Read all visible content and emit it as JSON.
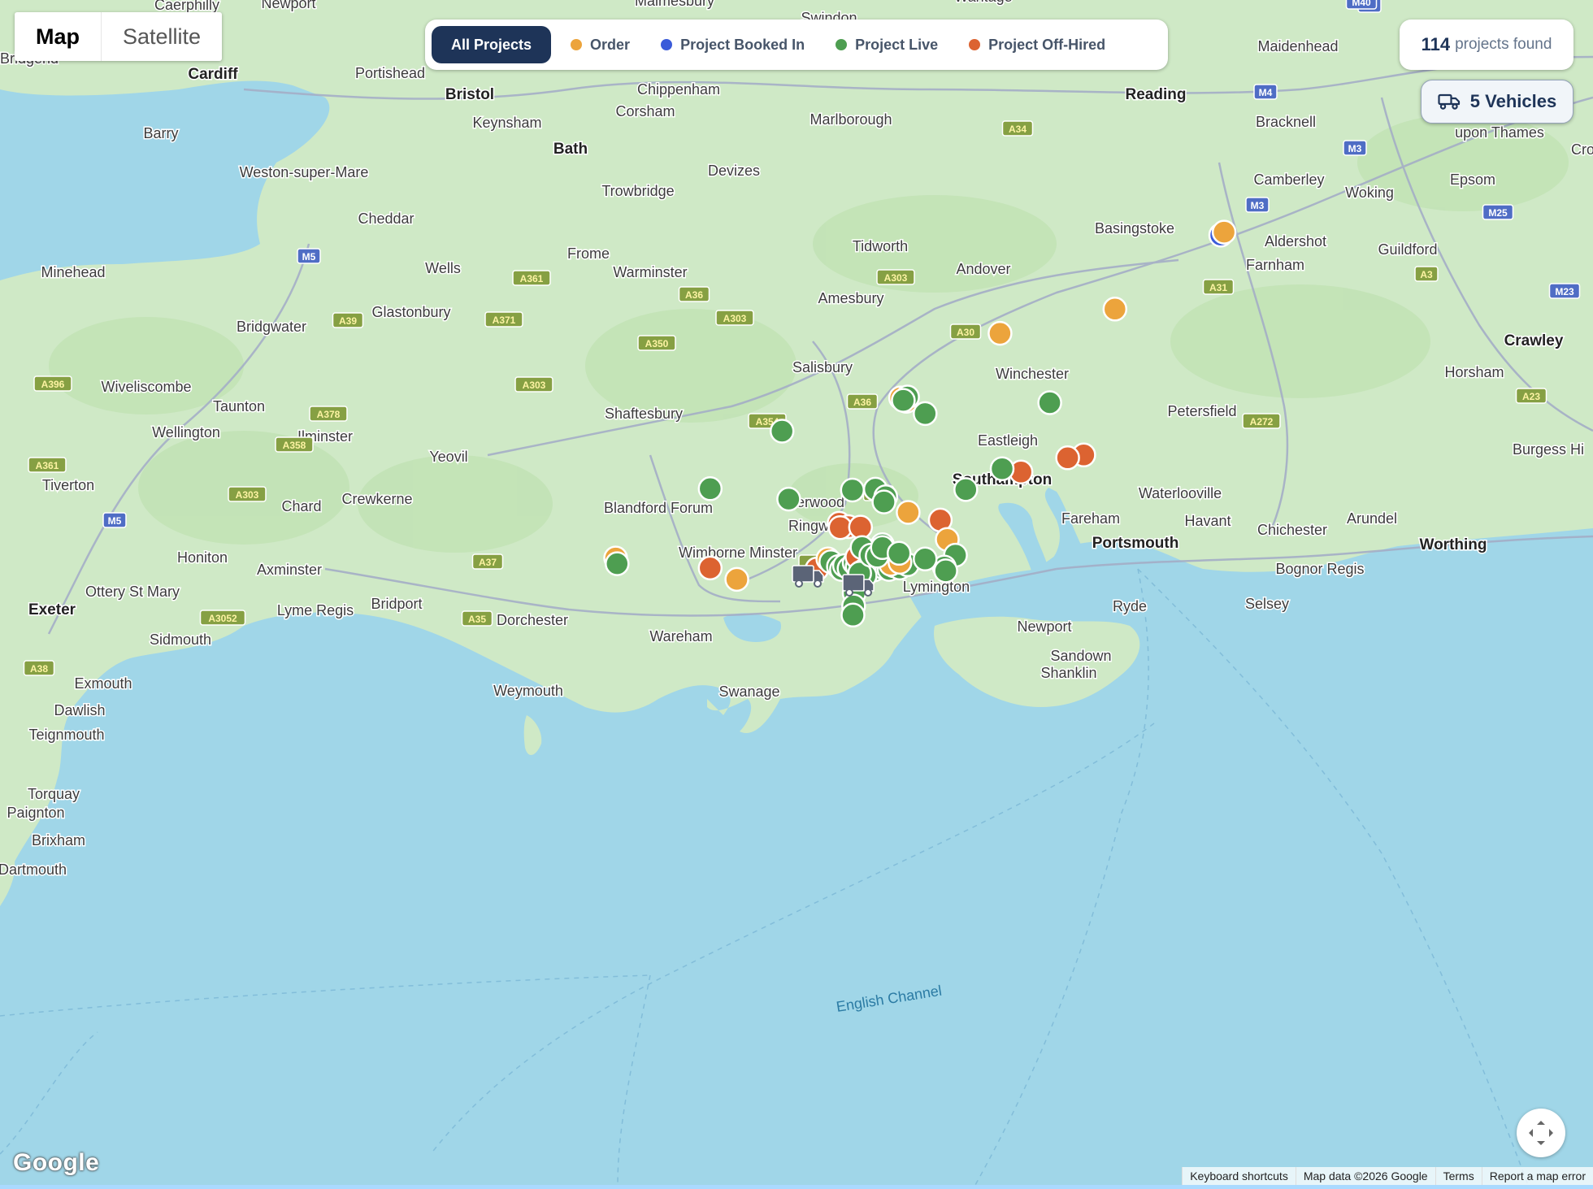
{
  "map_type": {
    "options": [
      "Map",
      "Satellite"
    ],
    "selected": "Map"
  },
  "filters": [
    {
      "label": "All Projects",
      "active": true
    },
    {
      "label": "Order",
      "color": "#eca43c"
    },
    {
      "label": "Project Booked In",
      "color": "#3b5bd9"
    },
    {
      "label": "Project Live",
      "color": "#4e9e51"
    },
    {
      "label": "Project Off-Hired",
      "color": "#dc6331"
    }
  ],
  "summary": {
    "count": "114",
    "count_label": "projects found",
    "vehicles_label": "5 Vehicles"
  },
  "attribution": {
    "logo": "Google",
    "links": [
      "Keyboard shortcuts",
      "Map data ©2026 Google",
      "Terms",
      "Report a map error"
    ]
  },
  "sea_labels": [
    "English Channel"
  ],
  "places": [
    "Caerphilly",
    "Newport",
    "Malmesbury",
    "Swindon",
    "Wantage",
    "Maidenhead",
    "Cardiff",
    "Portishead",
    "Bristol",
    "Chippenham",
    "Reading",
    "Barry",
    "Keynsham",
    "Corsham",
    "Marlborough",
    "upon Thames",
    "Croydo",
    "Bath",
    "Weston-super-Mare",
    "Devizes",
    "Camberley",
    "Woking",
    "Epsom",
    "Trowbridge",
    "Cheddar",
    "Basingstoke",
    "Aldershot",
    "Guildford",
    "Frome",
    "Tidworth",
    "Farnham",
    "Minehead",
    "Wells",
    "Warminster",
    "Andover",
    "Amesbury",
    "Glastonbury",
    "Bridgwater",
    "Crawley",
    "Wiveliscombe",
    "Horsham",
    "Taunton",
    "Shaftesbury",
    "Wellington",
    "Petersfield",
    "Eastleigh",
    "Burgess Hi",
    "Ilminster",
    "Yeovil",
    "Southampton",
    "Tiverton",
    "Crewkerne",
    "Chard",
    "Waterlooville",
    "Fareham",
    "Havant",
    "Arundel",
    "Portsmouth",
    "Chichester",
    "Worthing",
    "Honiton",
    "Axminster",
    "Blandford Forum",
    "Verwood",
    "Ringwood",
    "Wimborne Minster",
    "Lymington",
    "Ottery St Mary",
    "Lyme Regis",
    "Bridport",
    "Dorchester",
    "Ryde",
    "Newport",
    "Bognor Regis",
    "Selsey",
    "Exeter",
    "Sidmouth",
    "Wareham",
    "Sandown",
    "Shanklin",
    "Exmouth",
    "Dawlish",
    "Weymouth",
    "Swanage",
    "Teignmouth",
    "Torquay",
    "Paignton",
    "Brixham",
    "Dartmouth",
    "Bracknell",
    "Winchester",
    "Salisbury",
    "Bridgend"
  ],
  "roads": [
    "M4",
    "M40",
    "A34",
    "M3",
    "M25",
    "A3",
    "M23",
    "A31",
    "A303",
    "A30",
    "A361",
    "A36",
    "A371",
    "A303",
    "A350",
    "M5",
    "A39",
    "A396",
    "A303",
    "A378",
    "A358",
    "A354",
    "A36",
    "A31",
    "A338",
    "A35",
    "A37",
    "A361",
    "A303",
    "A3052",
    "A38",
    "M5",
    "A23",
    "A272",
    "M4",
    "M3"
  ],
  "vehicles": [
    {
      "name": "vehicle-1"
    },
    {
      "name": "vehicle-2"
    }
  ],
  "markers": [
    {
      "s": "booked",
      "lon": -0.749,
      "lat": 51.418
    },
    {
      "s": "order",
      "lon": -0.738,
      "lat": 51.424
    },
    {
      "s": "order",
      "lon": -1.098,
      "lat": 51.262
    },
    {
      "s": "order",
      "lon": -1.477,
      "lat": 51.211
    },
    {
      "s": "order",
      "lon": -1.805,
      "lat": 51.075
    },
    {
      "s": "order",
      "lon": -1.786,
      "lat": 51.068
    },
    {
      "s": "live",
      "lon": -1.782,
      "lat": 51.077
    },
    {
      "s": "live",
      "lon": -1.796,
      "lat": 51.07
    },
    {
      "s": "live",
      "lon": -1.724,
      "lat": 51.042
    },
    {
      "s": "live",
      "lon": -1.313,
      "lat": 51.065
    },
    {
      "s": "live",
      "lon": -2.196,
      "lat": 51.005
    },
    {
      "s": "offhired",
      "lon": -1.201,
      "lat": 50.955
    },
    {
      "s": "offhired",
      "lon": -1.254,
      "lat": 50.949
    },
    {
      "s": "offhired",
      "lon": -1.408,
      "lat": 50.919
    },
    {
      "s": "live",
      "lon": -1.47,
      "lat": 50.926
    },
    {
      "s": "live",
      "lon": -1.59,
      "lat": 50.882
    },
    {
      "s": "live",
      "lon": -2.433,
      "lat": 50.884
    },
    {
      "s": "live",
      "lon": -2.174,
      "lat": 50.862
    },
    {
      "s": "live",
      "lon": -1.964,
      "lat": 50.881
    },
    {
      "s": "live",
      "lon": -1.888,
      "lat": 50.883
    },
    {
      "s": "live",
      "lon": -1.854,
      "lat": 50.867
    },
    {
      "s": "live",
      "lon": -1.86,
      "lat": 50.856
    },
    {
      "s": "order",
      "lon": -1.78,
      "lat": 50.834
    },
    {
      "s": "offhired",
      "lon": -1.674,
      "lat": 50.818
    },
    {
      "s": "order",
      "lon": -1.651,
      "lat": 50.777
    },
    {
      "s": "offhired",
      "lon": -2.008,
      "lat": 50.811
    },
    {
      "s": "offhired",
      "lon": -1.977,
      "lat": 50.804
    },
    {
      "s": "offhired",
      "lon": -2.004,
      "lat": 50.802
    },
    {
      "s": "offhired",
      "lon": -1.937,
      "lat": 50.803
    },
    {
      "s": "live",
      "lon": -1.865,
      "lat": 50.766
    },
    {
      "s": "live",
      "lon": -1.624,
      "lat": 50.744
    },
    {
      "s": "live",
      "lon": -1.661,
      "lat": 50.719
    },
    {
      "s": "order",
      "lon": -2.745,
      "lat": 50.738
    },
    {
      "s": "live",
      "lon": -2.74,
      "lat": 50.726
    },
    {
      "s": "offhired",
      "lon": -2.433,
      "lat": 50.717
    },
    {
      "s": "order",
      "lon": -2.345,
      "lat": 50.693
    },
    {
      "s": "offhired",
      "lon": -2.081,
      "lat": 50.715
    },
    {
      "s": "order",
      "lon": -2.045,
      "lat": 50.736
    },
    {
      "s": "live",
      "lon": -2.035,
      "lat": 50.73
    },
    {
      "s": "live",
      "lon": -2.01,
      "lat": 50.72
    },
    {
      "s": "live",
      "lon": -2.0,
      "lat": 50.714
    },
    {
      "s": "live",
      "lon": -1.99,
      "lat": 50.722
    },
    {
      "s": "live",
      "lon": -1.975,
      "lat": 50.716
    },
    {
      "s": "live",
      "lon": -1.958,
      "lat": 50.728
    },
    {
      "s": "live",
      "lon": -1.948,
      "lat": 50.72
    },
    {
      "s": "live",
      "lon": -1.936,
      "lat": 50.714
    },
    {
      "s": "live",
      "lon": -1.923,
      "lat": 50.722
    },
    {
      "s": "live",
      "lon": -1.908,
      "lat": 50.719
    },
    {
      "s": "live",
      "lon": -1.893,
      "lat": 50.713
    },
    {
      "s": "live",
      "lon": -1.878,
      "lat": 50.721
    },
    {
      "s": "live",
      "lon": -1.861,
      "lat": 50.718
    },
    {
      "s": "live",
      "lon": -1.843,
      "lat": 50.714
    },
    {
      "s": "live",
      "lon": -1.828,
      "lat": 50.722
    },
    {
      "s": "live",
      "lon": -1.808,
      "lat": 50.717
    },
    {
      "s": "live",
      "lon": -1.782,
      "lat": 50.724
    },
    {
      "s": "order",
      "lon": -1.838,
      "lat": 50.725
    },
    {
      "s": "order",
      "lon": -1.807,
      "lat": 50.729
    },
    {
      "s": "offhired",
      "lon": -1.949,
      "lat": 50.74
    },
    {
      "s": "offhired",
      "lon": -1.936,
      "lat": 50.708
    },
    {
      "s": "offhired",
      "lon": -1.925,
      "lat": 50.712
    },
    {
      "s": "live",
      "lon": -1.922,
      "lat": 50.701
    },
    {
      "s": "live",
      "lon": -1.94,
      "lat": 50.706
    },
    {
      "s": "live",
      "lon": -1.932,
      "lat": 50.76
    },
    {
      "s": "live",
      "lon": -1.903,
      "lat": 50.744
    },
    {
      "s": "live",
      "lon": -1.882,
      "lat": 50.742
    },
    {
      "s": "live",
      "lon": -1.865,
      "lat": 50.76
    },
    {
      "s": "live",
      "lon": -1.81,
      "lat": 50.748
    },
    {
      "s": "live",
      "lon": -1.724,
      "lat": 50.736
    },
    {
      "s": "live",
      "lon": -1.656,
      "lat": 50.711
    },
    {
      "s": "live",
      "lon": -1.958,
      "lat": 50.664
    },
    {
      "s": "live",
      "lon": -1.96,
      "lat": 50.637
    },
    {
      "s": "live",
      "lon": -1.962,
      "lat": 50.618
    }
  ]
}
